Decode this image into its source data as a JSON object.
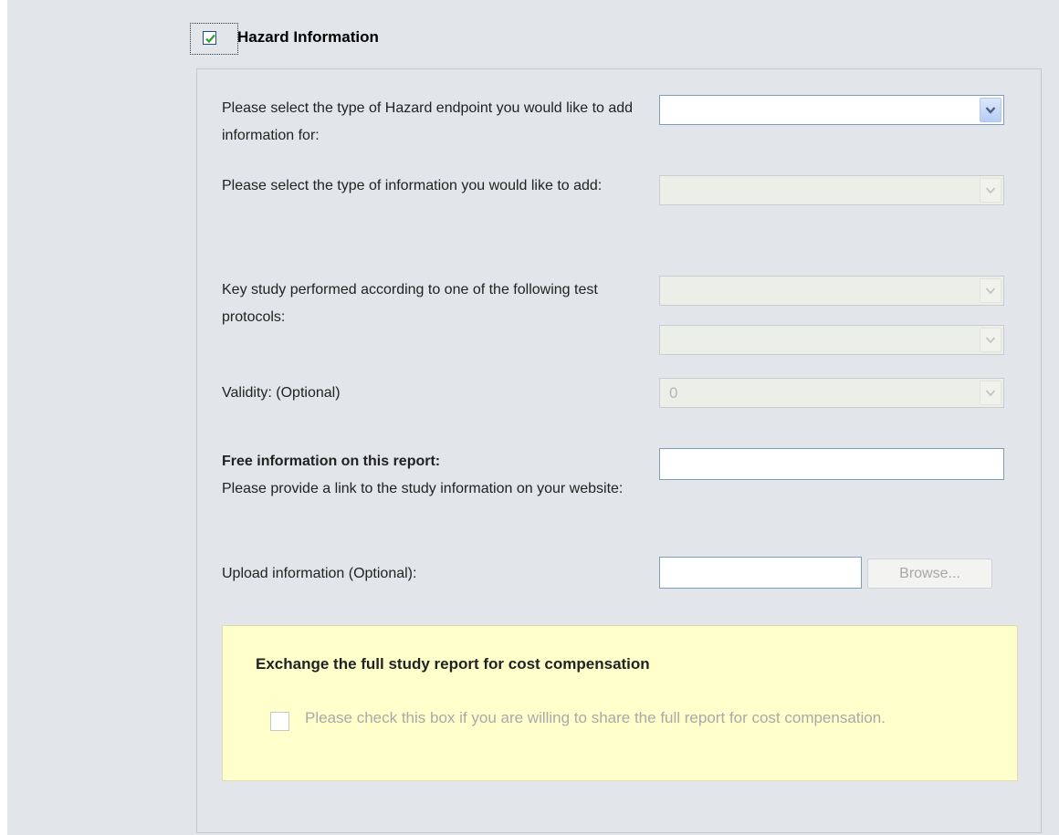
{
  "section": {
    "title": "Hazard Information",
    "checked": true
  },
  "fields": {
    "hazard_endpoint": {
      "label": "Please select the type of Hazard endpoint you would like to add information for:",
      "value": ""
    },
    "info_type": {
      "label": "Please select the type of information you would like to add:",
      "value": ""
    },
    "key_study": {
      "label": "Key study performed according to one of the following test protocols:",
      "value_1": "",
      "value_2": ""
    },
    "validity": {
      "label": "Validity: (Optional)",
      "value": "0"
    },
    "free_info": {
      "heading": "Free information on this report:",
      "label": "Please provide a link to the study information on your website:",
      "value": ""
    },
    "upload": {
      "label": "Upload information (Optional):",
      "browse_label": "Browse..."
    }
  },
  "exchange": {
    "title": "Exchange the full study report for cost compensation",
    "checkbox_label": "Please check this box if you are willing to share the full report for cost compensation.",
    "checked": false
  },
  "colors": {
    "background": "#e2e5e9",
    "yellow_box": "#ffffcc",
    "check_mark": "#2e9e2e"
  },
  "icons": {
    "section_check": "check-icon",
    "dropdown": "chevron-down-icon"
  }
}
